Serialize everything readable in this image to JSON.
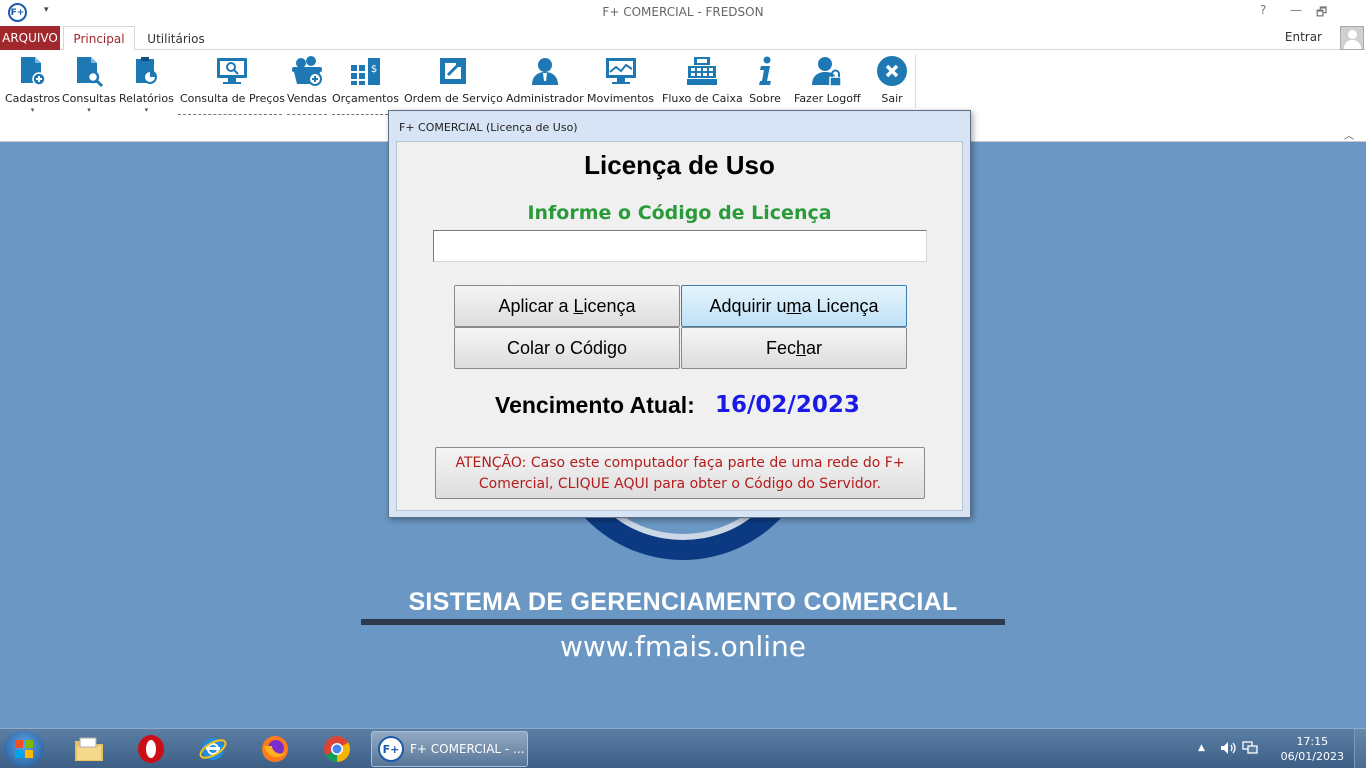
{
  "window": {
    "title": "F+ COMERCIAL - FREDSON",
    "app_icon_text": "F+",
    "help": "?",
    "minimize": "—",
    "restore": "🗗",
    "quick_access": "▾"
  },
  "tabs": {
    "arquivo": "ARQUIVO",
    "principal": "Principal",
    "utilitarios": "Utilitários",
    "user_label": "Entrar"
  },
  "ribbon": {
    "buttons": [
      {
        "label": "Cadastros",
        "icon": "document-add-icon",
        "dropdown": true
      },
      {
        "label": "Consultas",
        "icon": "document-search-icon",
        "dropdown": true
      },
      {
        "label": "Relatórios",
        "icon": "clipboard-chart-icon",
        "dropdown": true
      },
      {
        "label": "Consulta de Preços",
        "icon": "monitor-search-icon"
      },
      {
        "label": "Vendas",
        "icon": "basket-add-icon"
      },
      {
        "label": "Orçamentos",
        "icon": "calculator-icon"
      },
      {
        "label": "Ordem de Serviço",
        "icon": "service-order-icon"
      },
      {
        "label": "Administrador",
        "icon": "admin-user-icon"
      },
      {
        "label": "Movimentos",
        "icon": "monitor-chart-icon"
      },
      {
        "label": "Fluxo de Caixa",
        "icon": "cash-register-icon"
      },
      {
        "label": "Sobre",
        "icon": "info-icon"
      },
      {
        "label": "Fazer Logoff",
        "icon": "user-lock-icon"
      },
      {
        "label": "Sair",
        "icon": "close-circle-icon"
      }
    ],
    "caret": "▾",
    "collapse": "︿"
  },
  "dialog": {
    "title": "F+ COMERCIAL (Licença de Uso)",
    "heading": "Licença de Uso",
    "subheading": "Informe o Código de Licença",
    "license_input_value": "",
    "apply_pre": "Aplicar a ",
    "apply_key": "L",
    "apply_post": "icença",
    "acquire_pre": "Adquirir u",
    "acquire_key": "m",
    "acquire_post": "a Licença",
    "paste_label": "Colar o Código",
    "close_pre": "Fec",
    "close_key": "h",
    "close_post": "ar",
    "due_label": "Vencimento Atual:",
    "due_date": "16/02/2023",
    "attention_line1": "ATENÇÃO: Caso este computador faça parte de uma rede do F+",
    "attention_line2": "Comercial, CLIQUE AQUI para obter o Código do Servidor."
  },
  "background": {
    "tagline": "SISTEMA DE GERENCIAMENTO COMERCIAL",
    "website": "www.fmais.online"
  },
  "taskbar": {
    "app_label": "F+ COMERCIAL - ...",
    "app_icon_text": "F+",
    "time": "17:15",
    "date": "06/01/2023",
    "tray_arrow": "▲"
  },
  "colors": {
    "accent_red": "#a0282c",
    "ribbon_icon": "#1e78b4",
    "desktop": "#6a97c4",
    "subheading_green": "#2a9a3a",
    "date_blue": "#1a1ae6",
    "warning_red": "#b51c1c"
  }
}
